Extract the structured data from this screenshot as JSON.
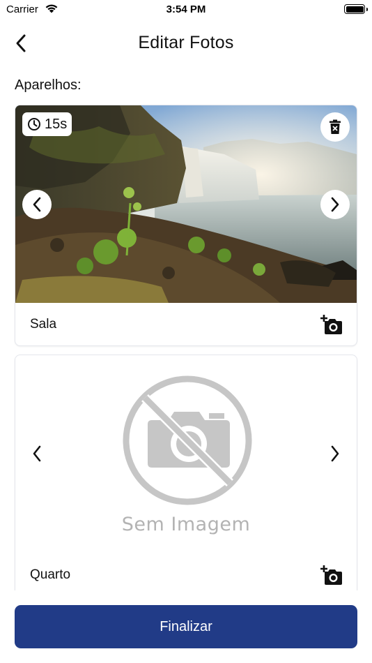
{
  "status_bar": {
    "carrier": "Carrier",
    "time": "3:54 PM"
  },
  "nav": {
    "title": "Editar Fotos",
    "back_icon": "chevron-left-icon"
  },
  "section": {
    "label": "Aparelhos:"
  },
  "devices": [
    {
      "room": "Sala",
      "timer": "15s",
      "has_image": true,
      "image_description": "waterfall landscape photo",
      "icons": [
        "clock-icon",
        "delete-icon",
        "chevron-left-icon",
        "chevron-right-icon",
        "add-photo-icon"
      ]
    },
    {
      "room": "Quarto",
      "has_image": false,
      "placeholder_text": "Sem Imagem",
      "icons": [
        "no-camera-icon",
        "chevron-left-icon",
        "chevron-right-icon",
        "add-photo-icon"
      ]
    }
  ],
  "footer": {
    "finish_label": "Finalizar"
  },
  "colors": {
    "primary": "#213b87",
    "placeholder_gray": "#b3b3b3",
    "card_border": "#e4e6ec"
  }
}
